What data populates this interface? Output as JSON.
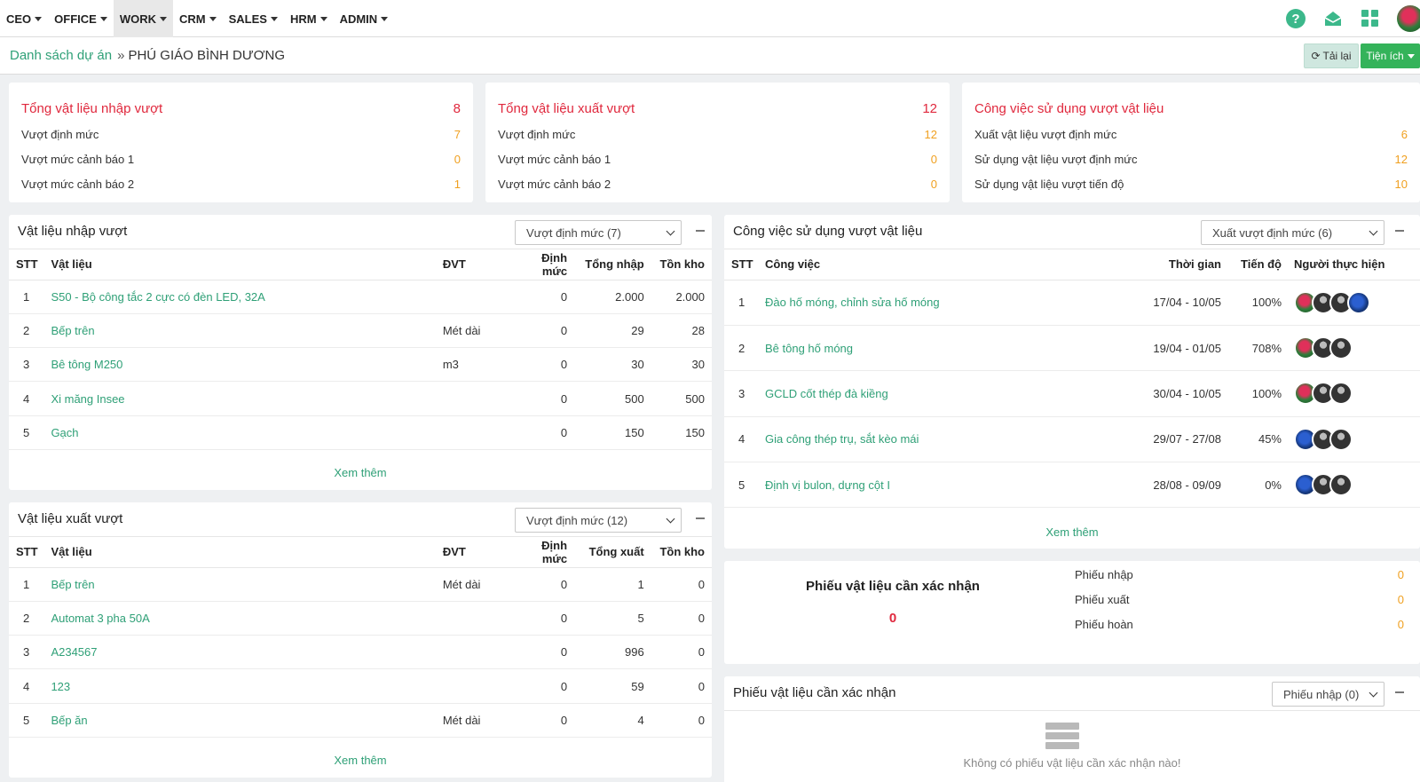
{
  "nav": {
    "menu": [
      "CEO",
      "OFFICE",
      "WORK",
      "CRM",
      "SALES",
      "HRM",
      "ADMIN"
    ],
    "active": "WORK",
    "icons": [
      "help-icon",
      "inbox-icon",
      "apps-grid-icon",
      "user-avatar"
    ]
  },
  "breadcrumb": {
    "parent": "Danh sách dự án",
    "separator": "»",
    "current": "PHÚ GIÁO BÌNH DƯƠNG"
  },
  "actions": {
    "reload": "Tải lại",
    "utilities": "Tiện ích"
  },
  "summary": [
    {
      "title": "Tổng vật liệu nhập vượt",
      "total": "8",
      "rows": [
        {
          "label": "Vượt định mức",
          "value": "7"
        },
        {
          "label": "Vượt mức cảnh báo 1",
          "value": "0"
        },
        {
          "label": "Vượt mức cảnh báo 2",
          "value": "1"
        }
      ]
    },
    {
      "title": "Tổng vật liệu xuất vượt",
      "total": "12",
      "rows": [
        {
          "label": "Vượt định mức",
          "value": "12"
        },
        {
          "label": "Vượt mức cảnh báo 1",
          "value": "0"
        },
        {
          "label": "Vượt mức cảnh báo 2",
          "value": "0"
        }
      ]
    },
    {
      "title": "Công việc sử dụng vượt vật liệu",
      "total": "",
      "rows": [
        {
          "label": "Xuất vật liệu vượt định mức",
          "value": "6"
        },
        {
          "label": "Sử dụng vật liệu vượt định mức",
          "value": "12"
        },
        {
          "label": "Sử dụng vật liệu vượt tiến độ",
          "value": "10"
        }
      ]
    }
  ],
  "import_panel": {
    "title": "Vật liệu nhập vượt",
    "filter": "Vượt định mức (7)",
    "columns": [
      "STT",
      "Vật liệu",
      "ĐVT",
      "Định mức",
      "Tổng nhập",
      "Tồn kho"
    ],
    "rows": [
      [
        "1",
        "S50 - Bộ công tắc 2 cực có đèn LED, 32A",
        "",
        "0",
        "2.000",
        "2.000"
      ],
      [
        "2",
        "Bếp trên",
        "Mét dài",
        "0",
        "29",
        "28"
      ],
      [
        "3",
        "Bê tông M250",
        "m3",
        "0",
        "30",
        "30"
      ],
      [
        "4",
        "Xi măng Insee",
        "",
        "0",
        "500",
        "500"
      ],
      [
        "5",
        "Gạch",
        "",
        "0",
        "150",
        "150"
      ]
    ],
    "more": "Xem thêm"
  },
  "export_panel": {
    "title": "Vật liệu xuất vượt",
    "filter": "Vượt định mức (12)",
    "columns": [
      "STT",
      "Vật liệu",
      "ĐVT",
      "Định mức",
      "Tổng xuất",
      "Tồn kho"
    ],
    "rows": [
      [
        "1",
        "Bếp trên",
        "Mét dài",
        "0",
        "1",
        "0"
      ],
      [
        "2",
        "Automat 3 pha 50A",
        "",
        "0",
        "5",
        "0"
      ],
      [
        "3",
        "A234567",
        "",
        "0",
        "996",
        "0"
      ],
      [
        "4",
        "123",
        "",
        "0",
        "59",
        "0"
      ],
      [
        "5",
        "Bếp ăn",
        "Mét dài",
        "0",
        "4",
        "0"
      ]
    ],
    "more": "Xem thêm"
  },
  "task_panel": {
    "title": "Công việc sử dụng vượt vật liệu",
    "filter": "Xuất vượt định mức (6)",
    "columns": [
      "STT",
      "Công việc",
      "Thời gian",
      "Tiến độ",
      "Người thực hiện"
    ],
    "rows": [
      {
        "stt": "1",
        "name": "Đào hố móng, chỉnh sửa hố móng",
        "time": "17/04 - 10/05",
        "progress": "100%",
        "people": [
          "rose",
          "user",
          "user",
          "blue"
        ]
      },
      {
        "stt": "2",
        "name": "Bê tông hố móng",
        "time": "19/04 - 01/05",
        "progress": "708%",
        "people": [
          "rose",
          "user",
          "user"
        ]
      },
      {
        "stt": "3",
        "name": "GCLD cốt thép đà kiềng",
        "time": "30/04 - 10/05",
        "progress": "100%",
        "people": [
          "rose",
          "user",
          "user"
        ]
      },
      {
        "stt": "4",
        "name": "Gia công thép trụ, sắt kèo mái",
        "time": "29/07 - 27/08",
        "progress": "45%",
        "people": [
          "blue",
          "user",
          "user"
        ]
      },
      {
        "stt": "5",
        "name": "Định vị bulon, dựng cột I",
        "time": "28/08 - 09/09",
        "progress": "0%",
        "people": [
          "blue",
          "user",
          "user"
        ]
      }
    ],
    "more": "Xem thêm"
  },
  "confirm_summary": {
    "title": "Phiếu vật liệu cần xác nhận",
    "total": "0",
    "rows": [
      {
        "label": "Phiếu nhập",
        "value": "0"
      },
      {
        "label": "Phiếu xuất",
        "value": "0"
      },
      {
        "label": "Phiếu hoàn",
        "value": "0"
      }
    ]
  },
  "confirm_panel": {
    "title": "Phiếu vật liệu cần xác nhận",
    "filter": "Phiếu nhập (0)",
    "empty": "Không có phiếu vật liệu cần xác nhận nào!"
  },
  "colors": {
    "accent": "#2fa077",
    "danger": "#e0283d",
    "warning": "#f0a020",
    "primary_button": "#34b35a"
  }
}
